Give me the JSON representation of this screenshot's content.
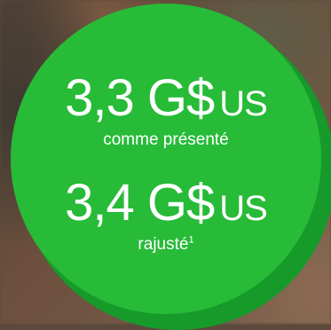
{
  "stats": [
    {
      "value": "3,3 G$",
      "unit": "US",
      "caption": "comme présenté"
    },
    {
      "value": "3,4 G$",
      "unit": "US",
      "caption": "rajusté",
      "footnote": "1"
    }
  ],
  "colors": {
    "circle": "#27bb38",
    "circle_shadow": "#169a2a",
    "text": "#ffffff"
  }
}
